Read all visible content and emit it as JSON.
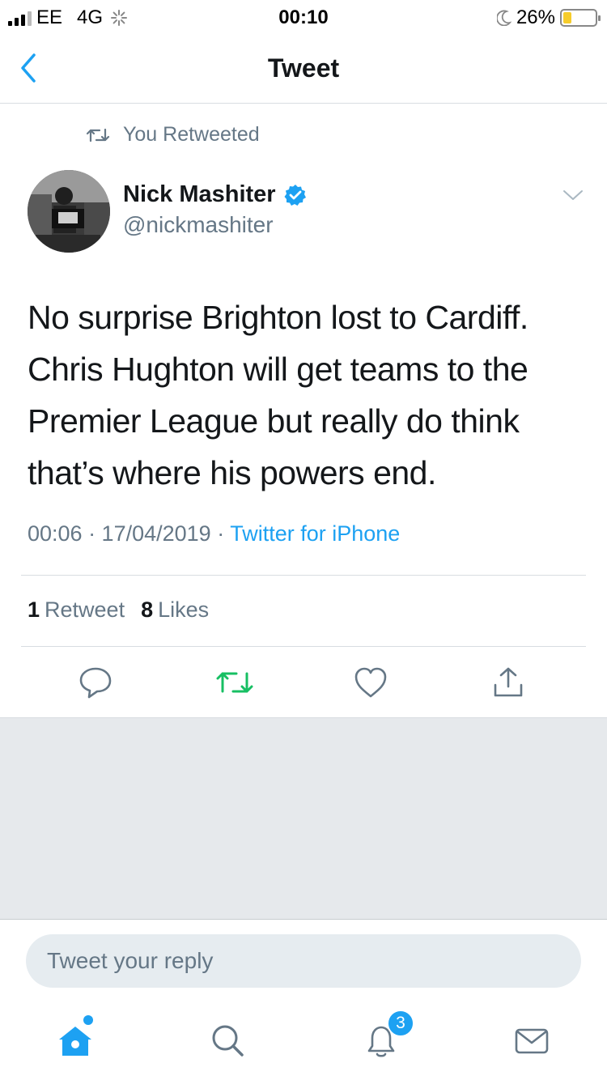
{
  "status_bar": {
    "carrier": "EE",
    "network": "4G",
    "time": "00:10",
    "battery_percent": "26%",
    "battery_level": 0.26,
    "battery_color": "#f6cc2b"
  },
  "nav": {
    "title": "Tweet",
    "back_icon": "chevron-left-icon"
  },
  "retweet_context": {
    "icon": "retweet-icon",
    "label": "You Retweeted"
  },
  "author": {
    "name": "Nick Mashiter",
    "handle": "@nickmashiter",
    "verified": true,
    "verified_icon": "verified-badge-icon"
  },
  "tweet": {
    "text": "No surprise Brighton lost to Cardiff. Chris Hughton will get teams to the Premier League but really do think that’s where his powers end.",
    "timestamp": "00:06 · 17/04/2019 · ",
    "source": "Twitter for iPhone"
  },
  "stats": {
    "retweets_count": "1",
    "retweets_label": "Retweet",
    "likes_count": "8",
    "likes_label": "Likes"
  },
  "actions": {
    "reply_icon": "reply-icon",
    "retweet_icon": "retweet-icon",
    "like_icon": "heart-icon",
    "share_icon": "share-icon",
    "retweet_active_color": "#17bf63"
  },
  "reply": {
    "placeholder": "Tweet your reply"
  },
  "tab_bar": {
    "home_icon": "home-icon",
    "search_icon": "search-icon",
    "notifications_icon": "bell-icon",
    "notifications_badge": "3",
    "messages_icon": "mail-icon",
    "accent_color": "#1da1f2"
  }
}
